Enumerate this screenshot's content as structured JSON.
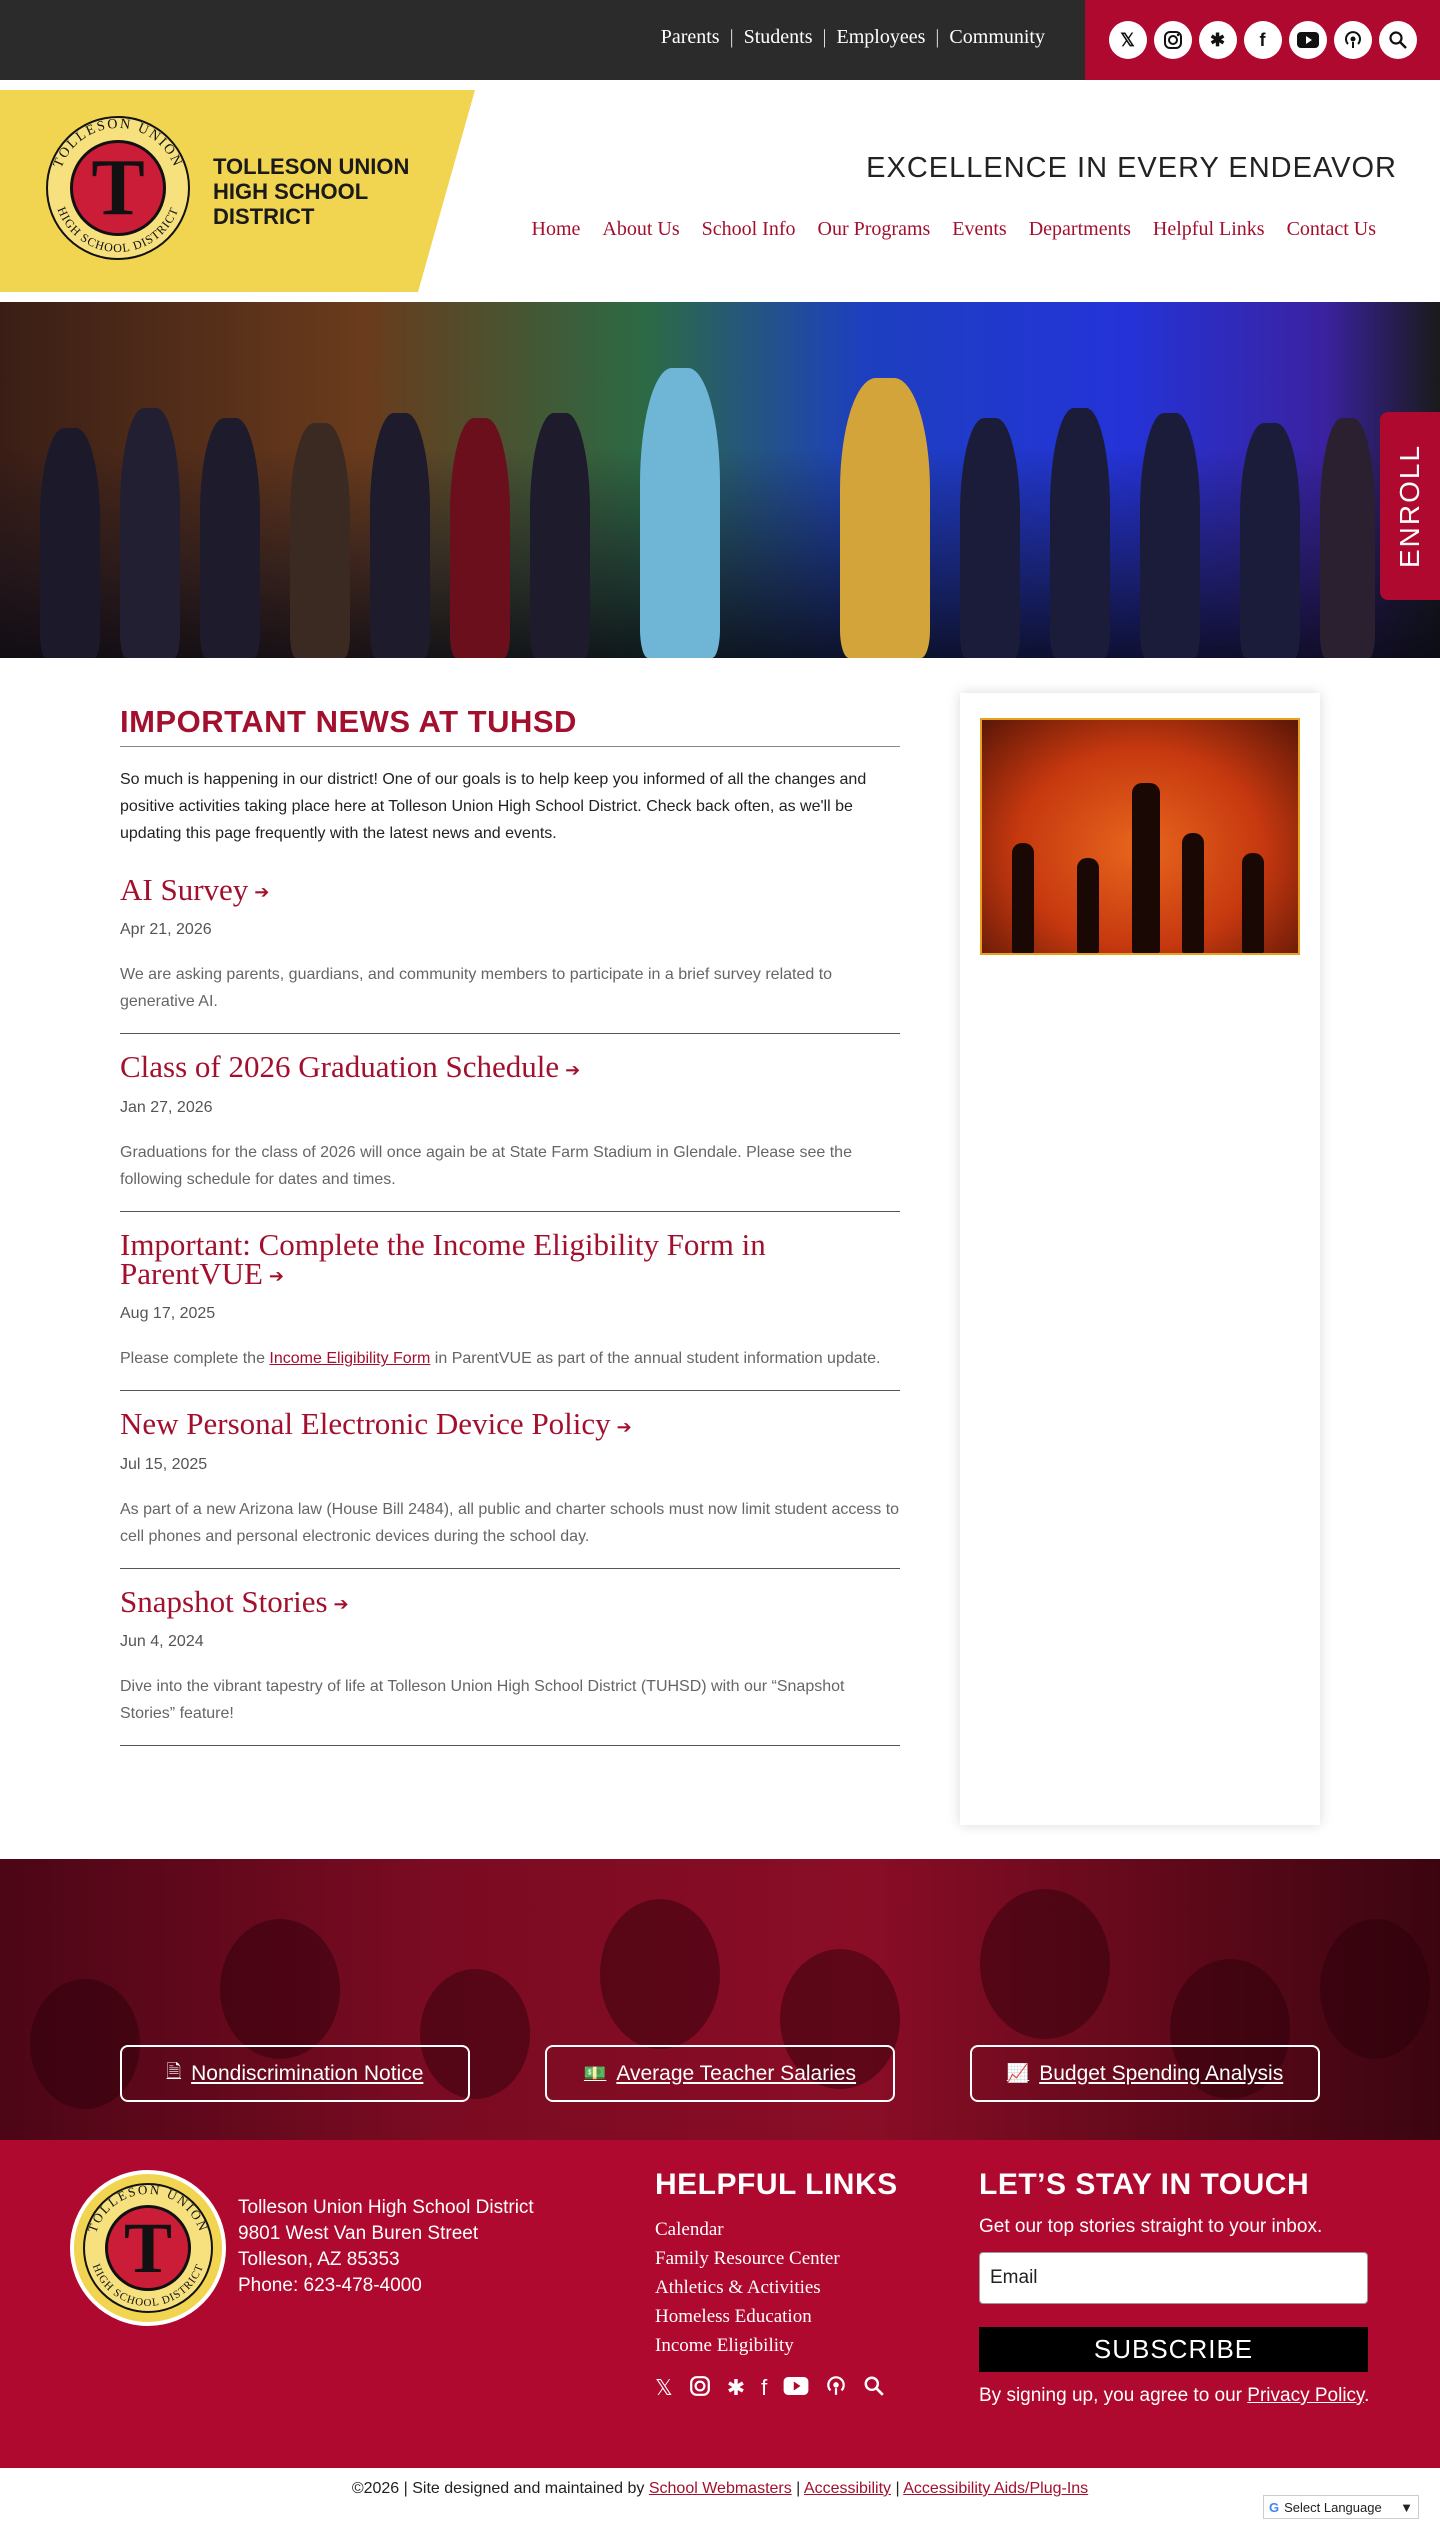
{
  "utility_nav": [
    "Parents",
    "Students",
    "Employees",
    "Community"
  ],
  "social_icons": [
    "x-icon",
    "instagram-icon",
    "linktree-icon",
    "facebook-icon",
    "youtube-icon",
    "podcast-icon",
    "search-icon"
  ],
  "header": {
    "seal_top_text": "TOLLESON UNION",
    "seal_bottom_text": "HIGH SCHOOL DISTRICT",
    "seal_letter": "T",
    "brand_name": "TOLLESON UNION HIGH SCHOOL DISTRICT",
    "tagline": "EXCELLENCE IN EVERY ENDEAVOR",
    "nav": [
      "Home",
      "About Us",
      "School Info",
      "Our Programs",
      "Events",
      "Departments",
      "Helpful Links",
      "Contact Us"
    ]
  },
  "enroll_label": "ENROLL",
  "main": {
    "title": "IMPORTANT NEWS AT TUHSD",
    "intro": "So much is happening in our district! One of our goals is to help keep you informed of all the changes and positive activities taking place here at Tolleson Union High School District. Check back often, as we'll be updating this page frequently with the latest news and events.",
    "news": [
      {
        "title": "AI Survey",
        "date": "Apr 21, 2026",
        "summary": "We are asking parents, guardians, and community members to participate in a brief survey related to generative AI."
      },
      {
        "title": "Class of 2026 Graduation Schedule",
        "date": "Jan 27, 2026",
        "summary": "Graduations for the class of 2026 will once again be at State Farm Stadium in Glendale. Please see the following schedule for dates and times."
      },
      {
        "title": "Important: Complete the Income Eligibility Form in ParentVUE",
        "date": "Aug 17, 2025",
        "summary_before": "Please complete the ",
        "summary_link": "Income Eligibility Form",
        "summary_after": " in ParentVUE as part of the annual student information update."
      },
      {
        "title": "New Personal Electronic Device Policy",
        "date": "Jul 15, 2025",
        "summary": "As part of a new Arizona law (House Bill 2484), all public and charter schools must now limit student access to cell phones and personal electronic devices during the school day."
      },
      {
        "title": "Snapshot Stories",
        "date": "Jun 4, 2024",
        "summary": "Dive into the vibrant tapestry of life at Tolleson Union High School District (TUHSD) with our “Snapshot Stories” feature!"
      }
    ]
  },
  "banner_buttons": [
    {
      "label": "Nondiscrimination Notice",
      "icon": "document-icon"
    },
    {
      "label": "Average Teacher Salaries",
      "icon": "money-icon"
    },
    {
      "label": "Budget Spending Analysis",
      "icon": "chart-icon"
    }
  ],
  "footer": {
    "address_lines": [
      "Tolleson Union High School District",
      "9801 West Van Buren Street",
      "Tolleson, AZ 85353",
      "Phone: 623-478-4000"
    ],
    "helpful_title": "HELPFUL LINKS",
    "helpful_links": [
      "Calendar",
      "Family Resource Center",
      "Athletics & Activities",
      "Homeless Education",
      "Income Eligibility"
    ],
    "stay_title": "LET’S STAY IN TOUCH",
    "stay_sub": "Get our top stories straight to your inbox.",
    "email_placeholder": "Email",
    "subscribe_label": "SUBSCRIBE",
    "privacy_before": "By signing up, you agree to our ",
    "privacy_link": "Privacy Policy",
    "privacy_after": "."
  },
  "copyright": {
    "text": "©2026 | Site designed and maintained by ",
    "link1": "School Webmasters",
    "sep": " | ",
    "link2": "Accessibility",
    "link3": "Accessibility Aids/Plug-Ins"
  },
  "translate_label": "Select Language",
  "colors": {
    "brand_red": "#b0092f",
    "title_red": "#a3102e",
    "gold": "#f1d44f",
    "topbar": "#2b2b2b"
  }
}
